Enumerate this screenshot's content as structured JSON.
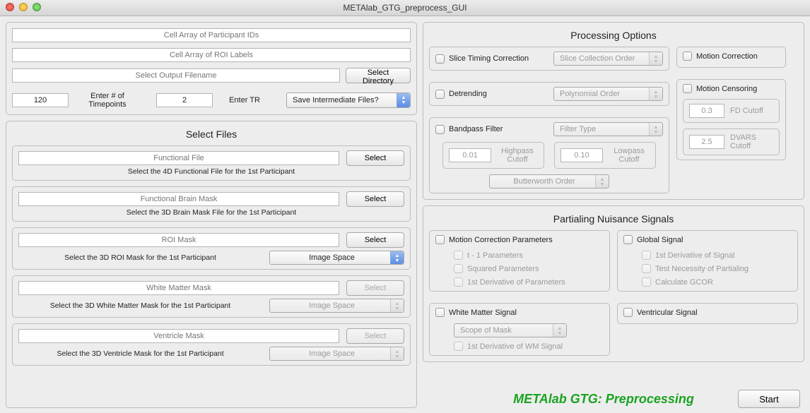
{
  "window": {
    "title": "METAlab_GTG_preprocess_GUI"
  },
  "top": {
    "participant_ids_placeholder": "Cell Array of Participant IDs",
    "roi_labels_placeholder": "Cell Array of ROI Labels",
    "output_filename_placeholder": "Select Output Filename",
    "select_directory_label": "Select Directory",
    "timepoints_value": "120",
    "timepoints_label": "Enter # of Timepoints",
    "tr_value": "2",
    "tr_label": "Enter TR",
    "save_intermediate_label": "Save Intermediate Files?"
  },
  "select_files": {
    "title": "Select Files",
    "select_label": "Select",
    "functional": {
      "placeholder": "Functional File",
      "desc": "Select the 4D Functional File for the 1st Participant"
    },
    "brainmask": {
      "placeholder": "Functional Brain Mask",
      "desc": "Select the 3D Brain Mask File for the 1st Participant"
    },
    "roimask": {
      "placeholder": "ROI Mask",
      "desc": "Select the 3D ROI Mask for the 1st Participant",
      "space_label": "Image Space"
    },
    "wmmask": {
      "placeholder": "White Matter Mask",
      "desc": "Select the 3D White Matter Mask for the 1st Participant",
      "space_label": "Image Space"
    },
    "ventmask": {
      "placeholder": "Ventricle Mask",
      "desc": "Select the 3D Ventricle Mask for the 1st Participant",
      "space_label": "Image Space"
    }
  },
  "processing": {
    "title": "Processing Options",
    "slice_timing_label": "Slice Timing Correction",
    "slice_order_label": "Slice Collection Order",
    "detrending_label": "Detrending",
    "poly_order_label": "Polynomial Order",
    "bandpass_label": "Bandpass Filter",
    "filter_type_label": "Filter Type",
    "highpass_value": "0.01",
    "highpass_label": "Highpass Cutoff",
    "lowpass_value": "0.10",
    "lowpass_label": "Lowpass Cutoff",
    "butter_label": "Butterworth Order",
    "motion_correction_label": "Motion Correction",
    "motion_censoring_label": "Motion Censoring",
    "fd_value": "0.3",
    "fd_label": "FD Cutoff",
    "dvars_value": "2.5",
    "dvars_label": "DVARS Cutoff"
  },
  "partialing": {
    "title": "Partialing Nuisance Signals",
    "motion_params_label": "Motion Correction Parameters",
    "t1_label": "t - 1 Parameters",
    "squared_label": "Squared Parameters",
    "first_deriv_params_label": "1st Derivative of Parameters",
    "global_signal_label": "Global Signal",
    "first_deriv_signal_label": "1st Derivative of Signal",
    "test_necessity_label": "Test Necessity of Partialing",
    "gcor_label": "Calculate GCOR",
    "wm_signal_label": "White Matter Signal",
    "scope_label": "Scope of Mask",
    "first_deriv_wm_label": "1st Derivative of WM Signal",
    "vent_signal_label": "Ventricular Signal"
  },
  "footer": {
    "brand": "METAlab GTG: Preprocessing",
    "start_label": "Start"
  }
}
